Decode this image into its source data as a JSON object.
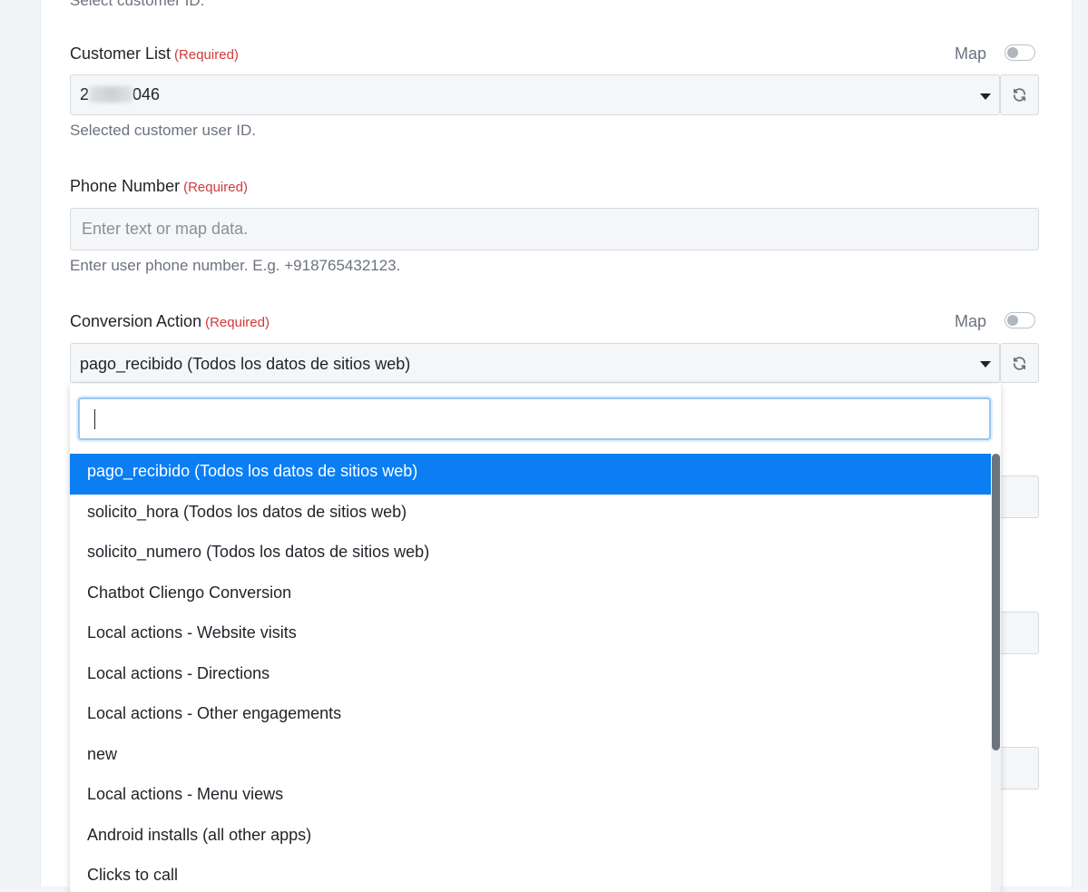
{
  "top_cut_hint": "Select customer ID.",
  "customer_list": {
    "label": "Customer List",
    "required": "(Required)",
    "map_label": "Map",
    "value_prefix": "2",
    "value_suffix": "046",
    "hint": "Selected customer user ID."
  },
  "phone_number": {
    "label": "Phone Number",
    "required": "(Required)",
    "placeholder": "Enter text or map data.",
    "value": "",
    "hint": "Enter user phone number. E.g. +918765432123."
  },
  "conversion_action": {
    "label": "Conversion Action",
    "required": "(Required)",
    "map_label": "Map",
    "value": "pago_recibido (Todos los datos de sitios web)"
  },
  "dropdown": {
    "search_value": "",
    "options": [
      "pago_recibido (Todos los datos de sitios web)",
      "solicito_hora (Todos los datos de sitios web)",
      "solicito_numero (Todos los datos de sitios web)",
      "Chatbot Cliengo Conversion",
      "Local actions - Website visits",
      "Local actions - Directions",
      "Local actions - Other engagements",
      "new",
      "Local actions - Menu views",
      "Android installs (all other apps)",
      "Clicks to call"
    ],
    "selected_index": 0
  },
  "colors": {
    "accent": "#0b7ef4",
    "required": "#d23a3a",
    "focus_ring": "#99c7f3"
  }
}
